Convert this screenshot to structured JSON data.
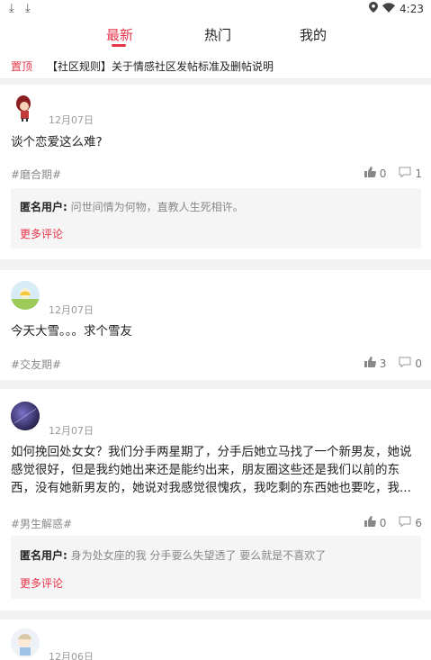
{
  "status_bar": {
    "time": "4:23",
    "left_icons": "⤓ ⤓"
  },
  "tabs": [
    {
      "label": "最新",
      "active": true
    },
    {
      "label": "热门",
      "active": false
    },
    {
      "label": "我的",
      "active": false
    }
  ],
  "pinned": {
    "tag": "置顶",
    "text": "【社区规则】关于情感社区发帖标准及删帖说明"
  },
  "posts": [
    {
      "date": "12月07日",
      "content": "谈个恋爱这么难?",
      "topic": "#磨合期#",
      "likes": "0",
      "comments": "1",
      "comment_user": "匿名用户:",
      "comment_text": "问世间情为何物，直教人生死相许。",
      "more_label": "更多评论"
    },
    {
      "date": "12月07日",
      "content": "今天大雪。。。求个雪友",
      "topic": "#交友期#",
      "likes": "3",
      "comments": "0"
    },
    {
      "date": "12月07日",
      "content_line1": "如何挽回处女女？我们分手两星期了，分手后她立马找了一个新男友，她说",
      "content_line2": "感觉很好，但是我约她出来还是能约出来，朋友圈这些还是我们以前的东",
      "content_line3": "西，没有她新男友的，她说对我感觉很愧疚，我吃剩的东西她也要吃，我...",
      "topic": "#男生解惑#",
      "likes": "0",
      "comments": "6",
      "comment_user": "匿名用户:",
      "comment_text": "身为处女座的我 分手要么失望透了 要么就是不喜欢了",
      "more_label": "更多评论"
    },
    {
      "date": "12月06日"
    }
  ],
  "colors": {
    "accent": "#e8344a",
    "gap": "#f2f2f2",
    "comment_bg": "#f5f5f5"
  },
  "icons": [
    "download-icon",
    "location-icon",
    "wifi-icon",
    "thumb-up-icon",
    "comment-icon"
  ]
}
